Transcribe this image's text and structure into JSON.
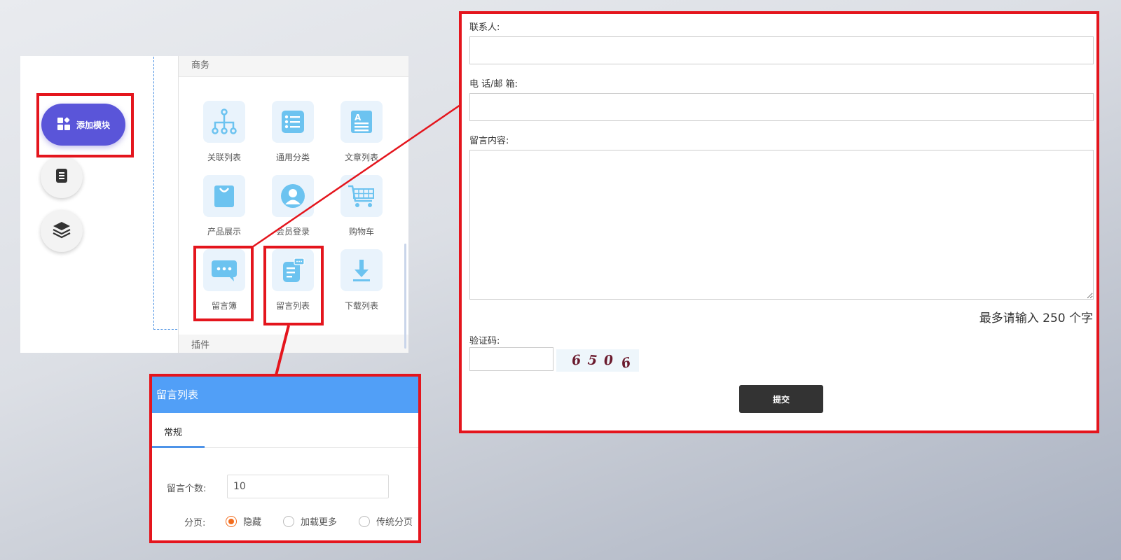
{
  "editor": {
    "add_module_label": "添加模块",
    "peek_chars": [
      "(",
      "("
    ],
    "library": {
      "section_business": "商务",
      "section_plugins": "插件",
      "modules": [
        {
          "label": "关联列表",
          "icon": "hierarchy-icon"
        },
        {
          "label": "通用分类",
          "icon": "list-icon"
        },
        {
          "label": "文章列表",
          "icon": "article-icon"
        },
        {
          "label": "产品展示",
          "icon": "shopping-bag-icon"
        },
        {
          "label": "会员登录",
          "icon": "user-icon"
        },
        {
          "label": "购物车",
          "icon": "cart-icon"
        },
        {
          "label": "留言簿",
          "icon": "chat-bubble-icon"
        },
        {
          "label": "留言列表",
          "icon": "message-list-icon"
        },
        {
          "label": "下载列表",
          "icon": "download-icon"
        }
      ]
    }
  },
  "settings": {
    "title": "留言列表",
    "tab_general": "常规",
    "message_count_label": "留言个数:",
    "message_count_value": "10",
    "pagination_label": "分页:",
    "pagination_options": [
      {
        "label": "隐藏",
        "checked": true
      },
      {
        "label": "加载更多",
        "checked": false
      },
      {
        "label": "传统分页",
        "checked": false
      }
    ]
  },
  "form": {
    "contact_label": "联系人:",
    "phone_email_label": "电 话/邮 箱:",
    "content_label": "留言内容:",
    "char_limit_text": "最多请输入 250 个字",
    "captcha_label": "验证码:",
    "captcha_chars": [
      "6",
      "5",
      "0",
      "6"
    ],
    "submit_label": "提交"
  },
  "colors": {
    "highlight_border": "#e4151d",
    "add_module_button": "#5a55d9",
    "settings_header": "#519ff7",
    "radio_checked": "#f26c1d",
    "submit_button": "#333333",
    "module_icon": "#6cc3f0"
  }
}
